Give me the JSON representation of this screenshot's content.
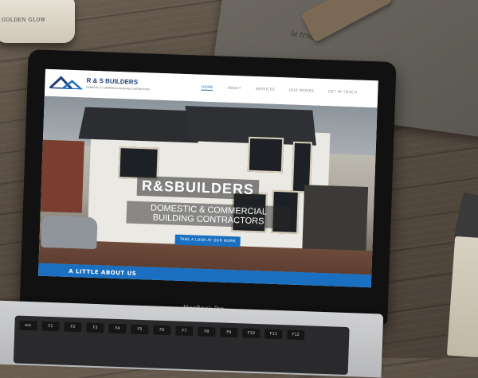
{
  "scene": {
    "jar_label": "GOLDEN GLOW",
    "bag_text": "la truffe"
  },
  "laptop": {
    "brand": "MacBook Pro"
  },
  "site": {
    "logo": {
      "title": "R & S BUILDERS",
      "subtitle": "DOMESTIC & COMMERCIAL BUILDING CONTRACTORS"
    },
    "nav": {
      "items": [
        "HOME",
        "ABOUT",
        "SERVICES",
        "OUR WORKS",
        "GET IN TOUCH"
      ],
      "active": "HOME"
    },
    "hero": {
      "title": "R&SBUILDERS",
      "subtitle": "DOMESTIC & COMMERCIAL BUILDING CONTRACTORS",
      "button": "TAKE A LOOK AT OUR WORK"
    },
    "about_bar": "A LITTLE ABOUT US",
    "colors": {
      "brand_blue": "#1a6fc0",
      "logo_navy": "#1f3d74"
    }
  },
  "keyboard": {
    "keys": [
      "esc",
      "F1",
      "F2",
      "F3",
      "F4",
      "F5",
      "F6",
      "F7",
      "F8",
      "F9",
      "F10",
      "F11",
      "F12"
    ]
  }
}
